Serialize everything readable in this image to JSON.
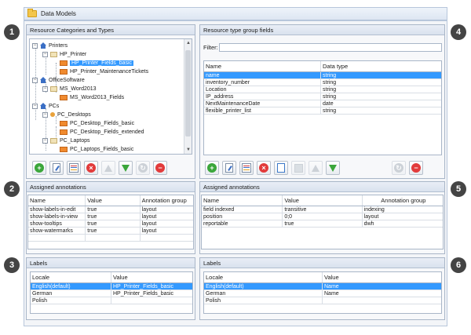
{
  "window": {
    "title": "Data Models",
    "icon": "folder-icon"
  },
  "badges": [
    "1",
    "2",
    "3",
    "4",
    "5",
    "6"
  ],
  "left": {
    "categories": {
      "header": "Resource Categories and Types",
      "tree": [
        {
          "label": "Printers",
          "icon": "house-icon",
          "expander": "−"
        },
        {
          "label": "HP_Printer",
          "icon": "type-folder-icon",
          "expander": "−"
        },
        {
          "label": "HP_Printer_Fields_basic",
          "icon": "field-group-icon",
          "selected": true
        },
        {
          "label": "HP_Printer_MaintenanceTickets",
          "icon": "field-group-icon"
        },
        {
          "label": "OfficeSoftware",
          "icon": "house-icon",
          "expander": "−"
        },
        {
          "label": "MS_Word2013",
          "icon": "type-folder-icon",
          "expander": "−"
        },
        {
          "label": "MS_Word2013_Fields",
          "icon": "field-group-icon"
        },
        {
          "label": "PCs",
          "icon": "house-icon",
          "expander": "−"
        },
        {
          "label": "PC_Desktops",
          "icon": "type-dot-icon",
          "expander": "−"
        },
        {
          "label": "PC_Desktop_Fields_basic",
          "icon": "field-group-icon"
        },
        {
          "label": "PC_Desktop_Fields_extended",
          "icon": "field-group-icon"
        },
        {
          "label": "PC_Laptops",
          "icon": "type-folder-icon",
          "expander": "−"
        },
        {
          "label": "PC_Laptops_Fields_basic",
          "icon": "field-group-icon"
        }
      ]
    },
    "annotations": {
      "header": "Assigned annotations",
      "columns": [
        "Name",
        "Value",
        "Annotation group"
      ],
      "rows": [
        [
          "show-labels-in-edit",
          "true",
          "layout"
        ],
        [
          "show-labels-in-view",
          "true",
          "layout"
        ],
        [
          "show-tooltips",
          "true",
          "layout"
        ],
        [
          "show-watermarks",
          "true",
          "layout"
        ]
      ]
    },
    "labels": {
      "header": "Labels",
      "columns": [
        "Locale",
        "Value"
      ],
      "rows": [
        [
          "English(default)",
          "HP_Printer_Fields_basic"
        ],
        [
          "German",
          "HP_Printer_Fields_basic"
        ],
        [
          "Polish",
          ""
        ]
      ]
    }
  },
  "right": {
    "fields": {
      "header": "Resource type group fields",
      "filter_label": "Filter:",
      "filter_value": "",
      "columns": [
        "Name",
        "Data type"
      ],
      "rows": [
        [
          "name",
          "string"
        ],
        [
          "inventory_number",
          "string"
        ],
        [
          "Location",
          "string"
        ],
        [
          "IP_address",
          "string"
        ],
        [
          "NextMaintenanceDate",
          "date"
        ],
        [
          "flexible_printer_list",
          "string"
        ]
      ]
    },
    "annotations": {
      "header": "Assigned annotations",
      "columns": [
        "Name",
        "Value",
        "Annotation group"
      ],
      "rows": [
        [
          "field indexed",
          "transitive",
          "indexing"
        ],
        [
          "position",
          "0;0",
          "layout"
        ],
        [
          "reportable",
          "true",
          "dwh"
        ]
      ]
    },
    "labels": {
      "header": "Labels",
      "columns": [
        "Locale",
        "Value"
      ],
      "rows": [
        [
          "English(default)",
          "Name"
        ],
        [
          "German",
          "Name"
        ],
        [
          "Polish",
          ""
        ]
      ]
    }
  }
}
